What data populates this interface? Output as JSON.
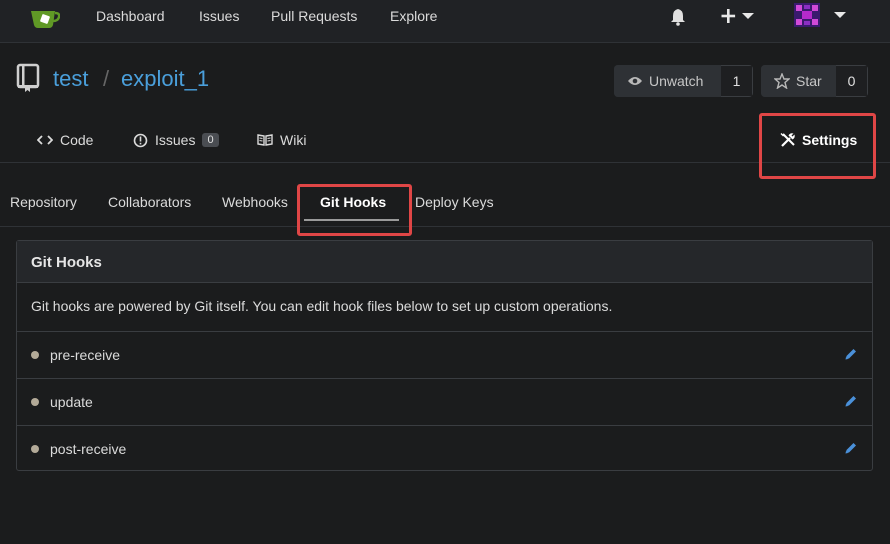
{
  "nav": {
    "dashboard": "Dashboard",
    "issues": "Issues",
    "pull_requests": "Pull Requests",
    "explore": "Explore"
  },
  "repo": {
    "owner": "test",
    "separator": "/",
    "name": "exploit_1",
    "unwatch_label": "Unwatch",
    "watch_count": "1",
    "star_label": "Star",
    "star_count": "0"
  },
  "tabs": {
    "code": "Code",
    "issues": "Issues",
    "issues_count": "0",
    "wiki": "Wiki",
    "settings": "Settings"
  },
  "settings_menu": {
    "repository": "Repository",
    "collaborators": "Collaborators",
    "webhooks": "Webhooks",
    "git_hooks": "Git Hooks",
    "deploy_keys": "Deploy Keys"
  },
  "panel": {
    "title": "Git Hooks",
    "description": "Git hooks are powered by Git itself. You can edit hook files below to set up custom operations.",
    "hooks": [
      "pre-receive",
      "update",
      "post-receive"
    ]
  },
  "colors": {
    "accent_link": "#4a9fdb",
    "highlight": "#e04646",
    "edit_icon": "#4a90d9"
  }
}
